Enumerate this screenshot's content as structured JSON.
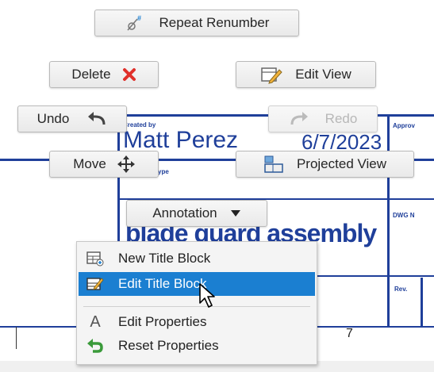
{
  "drawing": {
    "created_by_label": "Created by",
    "created_by_value": "Matt Perez",
    "date_value": "6/7/2023",
    "document_type_label": "Document type",
    "approved_label": "Approv",
    "dwg_label": "DWG N",
    "title_value": "blade guard assembly",
    "rev_label": "Rev.",
    "sheet_number": "7"
  },
  "marking_menu": {
    "repeat_renumber": "Repeat Renumber",
    "delete": "Delete",
    "edit_view": "Edit View",
    "undo": "Undo",
    "redo": "Redo",
    "move": "Move",
    "projected_view": "Projected View",
    "annotation": "Annotation"
  },
  "context_menu": {
    "items": [
      {
        "label": "New Title Block",
        "icon": "new-title-block-icon"
      },
      {
        "label": "Edit Title Block",
        "icon": "edit-title-block-icon",
        "selected": true
      },
      {
        "label": "Edit Properties",
        "icon": "letter-a-icon"
      },
      {
        "label": "Reset Properties",
        "icon": "reset-arrow-icon"
      }
    ]
  },
  "colors": {
    "drawing_blue": "#1f3f9a",
    "selection_blue": "#1b7fd1",
    "delete_red": "#e0302a",
    "reset_green": "#3a9a3a"
  }
}
